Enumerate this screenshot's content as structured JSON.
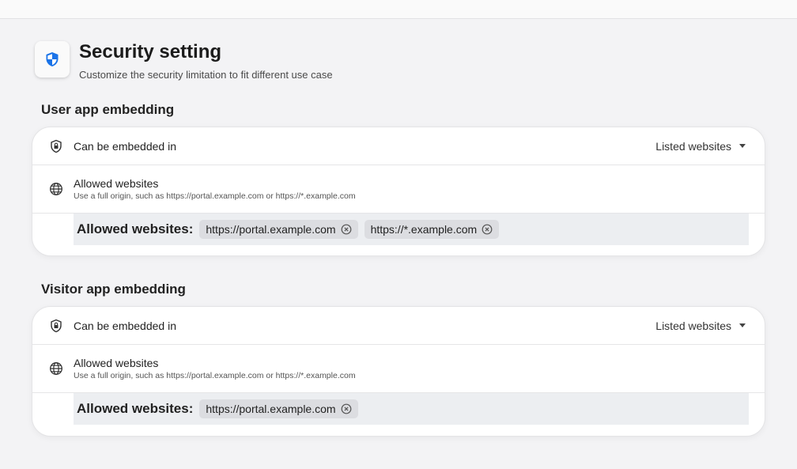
{
  "header": {
    "title": "Security setting",
    "subtitle": "Customize the security limitation to fit different use case",
    "icon": "shield-icon",
    "accent": "#1a73e8"
  },
  "sections": [
    {
      "title": "User app embedding",
      "embed_label": "Can be embedded in",
      "embed_value": "Listed websites",
      "allowed_label": "Allowed websites",
      "allowed_hint": "Use a full origin, such as https://portal.example.com or https://*.example.com",
      "tags_label": "Allowed websites:",
      "tags": [
        "https://portal.example.com",
        "https://*.example.com"
      ]
    },
    {
      "title": "Visitor app embedding",
      "embed_label": "Can be embedded in",
      "embed_value": "Listed websites",
      "allowed_label": "Allowed websites",
      "allowed_hint": "Use a full origin, such as https://portal.example.com or https://*.example.com",
      "tags_label": "Allowed websites:",
      "tags": [
        "https://portal.example.com"
      ]
    }
  ]
}
